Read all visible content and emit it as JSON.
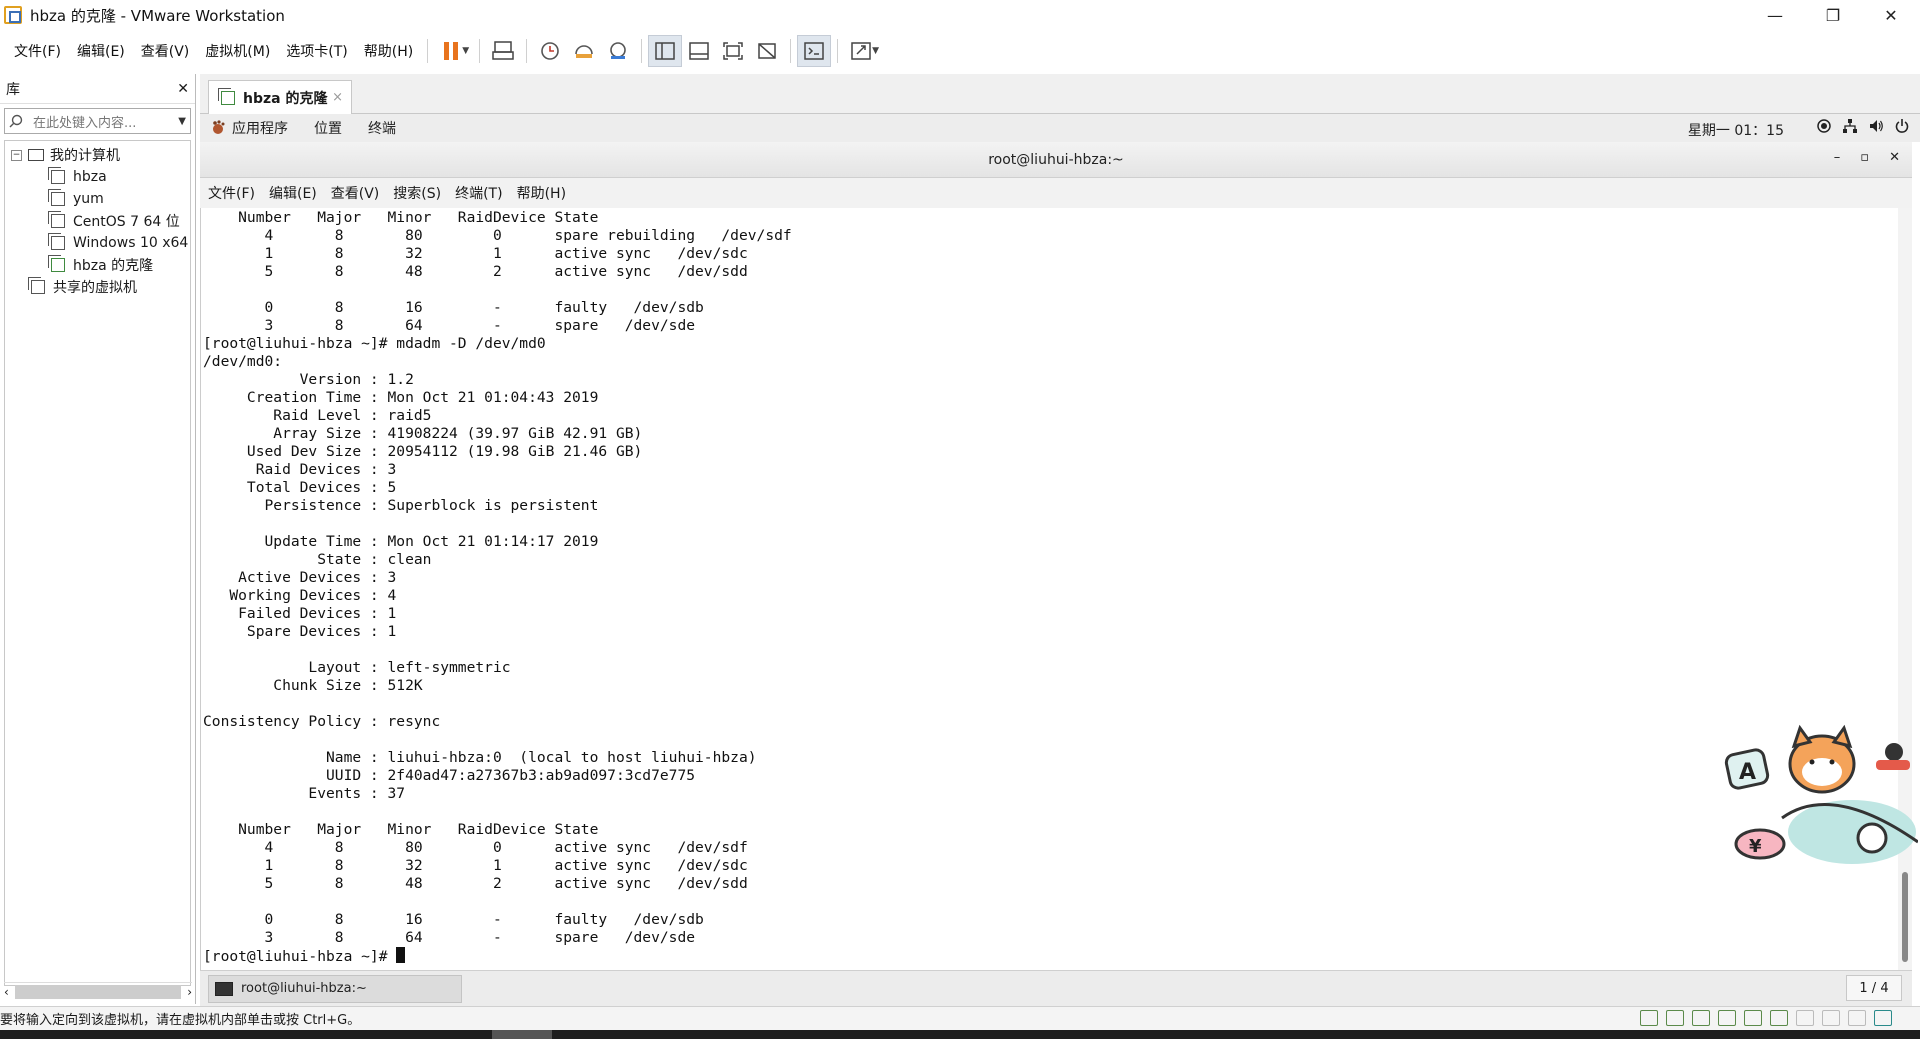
{
  "window": {
    "title": "hbza 的克隆 - VMware Workstation",
    "controls": {
      "minimize": "—",
      "restore": "❐",
      "close": "✕"
    }
  },
  "menubar": {
    "items": [
      "文件(F)",
      "编辑(E)",
      "查看(V)",
      "虚拟机(M)",
      "选项卡(T)",
      "帮助(H)"
    ]
  },
  "toolbar": {
    "pause_color": "#e8731d",
    "buttons": [
      "pause",
      "send-ctrl-alt-del",
      "snapshot-take",
      "snapshot-revert",
      "snapshot-manager",
      "library-view",
      "thumbnail-view",
      "fullscreen",
      "unity",
      "console",
      "stretch"
    ]
  },
  "library": {
    "title": "库",
    "close": "✕",
    "search_placeholder": "在此处键入内容...",
    "tree": {
      "root": "我的计算机",
      "vms": [
        "hbza",
        "yum",
        "CentOS 7 64 位",
        "Windows 10 x64",
        "hbza 的克隆"
      ],
      "shared": "共享的虚拟机"
    }
  },
  "vm_tab": {
    "label": "hbza 的克隆",
    "close": "×"
  },
  "gnome": {
    "apps": "应用程序",
    "places": "位置",
    "terminal": "终端",
    "clock": "星期一 01：15"
  },
  "terminal": {
    "title": "root@liuhui-hbza:~",
    "controls": {
      "min": "–",
      "max": "▫",
      "close": "✕"
    },
    "menu": [
      "文件(F)",
      "编辑(E)",
      "查看(V)",
      "搜索(S)",
      "终端(T)",
      "帮助(H)"
    ],
    "lines": [
      "    Number   Major   Minor   RaidDevice State",
      "       4       8       80        0      spare rebuilding   /dev/sdf",
      "       1       8       32        1      active sync   /dev/sdc",
      "       5       8       48        2      active sync   /dev/sdd",
      "",
      "       0       8       16        -      faulty   /dev/sdb",
      "       3       8       64        -      spare   /dev/sde",
      "[root@liuhui-hbza ~]# mdadm -D /dev/md0",
      "/dev/md0:",
      "           Version : 1.2",
      "     Creation Time : Mon Oct 21 01:04:43 2019",
      "        Raid Level : raid5",
      "        Array Size : 41908224 (39.97 GiB 42.91 GB)",
      "     Used Dev Size : 20954112 (19.98 GiB 21.46 GB)",
      "      Raid Devices : 3",
      "     Total Devices : 5",
      "       Persistence : Superblock is persistent",
      "",
      "       Update Time : Mon Oct 21 01:14:17 2019",
      "             State : clean",
      "    Active Devices : 3",
      "   Working Devices : 4",
      "    Failed Devices : 1",
      "     Spare Devices : 1",
      "",
      "            Layout : left-symmetric",
      "        Chunk Size : 512K",
      "",
      "Consistency Policy : resync",
      "",
      "              Name : liuhui-hbza:0  (local to host liuhui-hbza)",
      "              UUID : 2f40ad47:a27367b3:ab9ad097:3cd7e775",
      "            Events : 37",
      "",
      "    Number   Major   Minor   RaidDevice State",
      "       4       8       80        0      active sync   /dev/sdf",
      "       1       8       32        1      active sync   /dev/sdc",
      "       5       8       48        2      active sync   /dev/sdd",
      "",
      "       0       8       16        -      faulty   /dev/sdb",
      "       3       8       64        -      spare   /dev/sde"
    ],
    "prompt": "[root@liuhui-hbza ~]# "
  },
  "vm_taskbar": {
    "task": "root@liuhui-hbza:~",
    "pager": "1 / 4"
  },
  "statusbar": {
    "message": "要将输入定向到该虚拟机，请在虚拟机内部单击或按 Ctrl+G。"
  }
}
